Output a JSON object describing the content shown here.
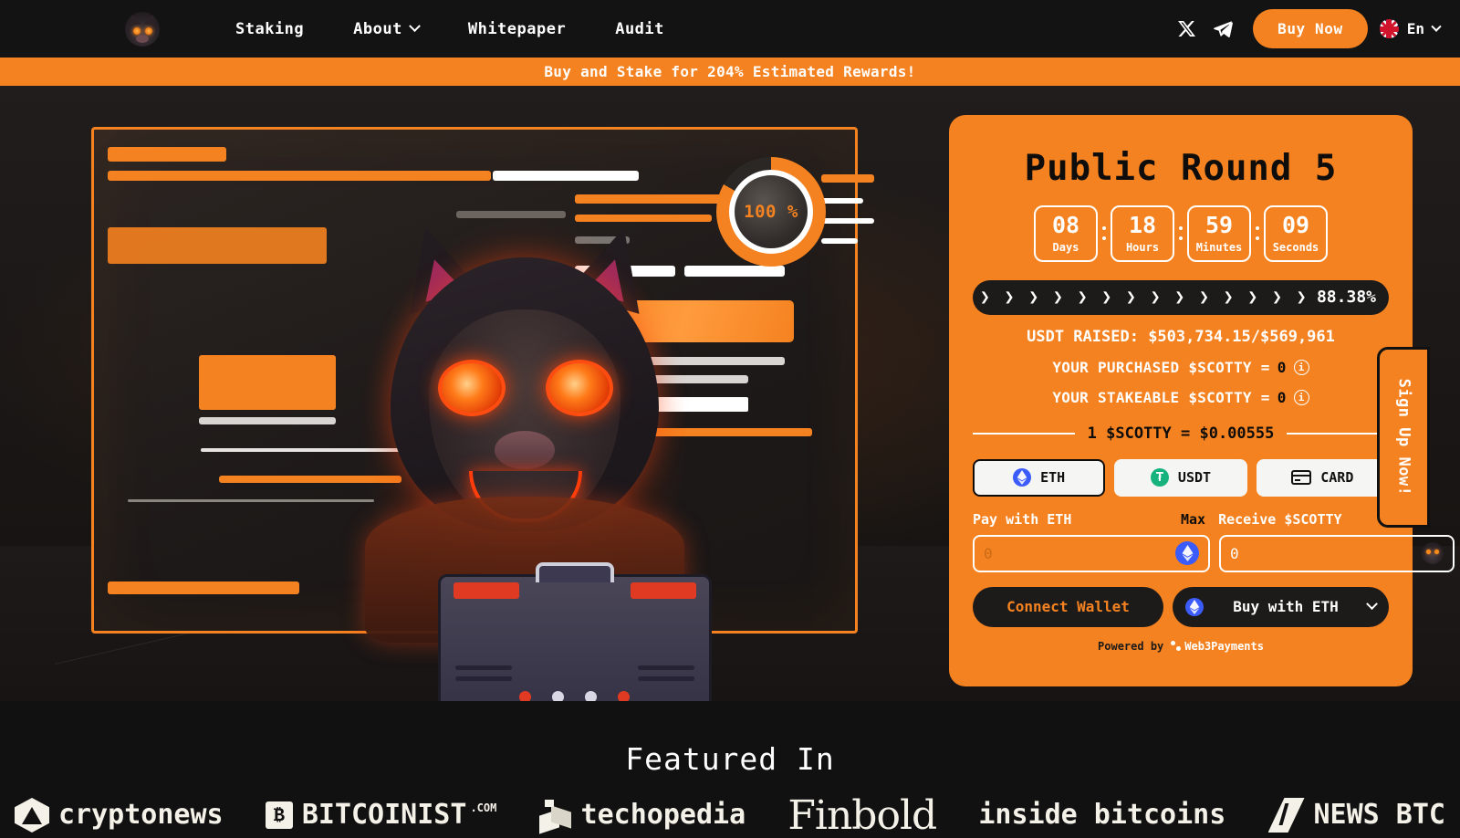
{
  "header": {
    "logo_alt": "scotty-dog-logo",
    "nav": [
      {
        "label": "Staking",
        "has_dropdown": false
      },
      {
        "label": "About",
        "has_dropdown": true
      },
      {
        "label": "Whitepaper",
        "has_dropdown": false
      },
      {
        "label": "Audit",
        "has_dropdown": false
      }
    ],
    "social": [
      {
        "name": "x-twitter-icon"
      },
      {
        "name": "telegram-icon"
      }
    ],
    "buy_now_label": "Buy Now",
    "language": "En"
  },
  "ticker": {
    "text": "Buy and Stake for 204% Estimated Rewards!"
  },
  "hero": {
    "gauge_value": "100 %"
  },
  "presale": {
    "title": "Public Round 5",
    "countdown": [
      {
        "value": "08",
        "label": "Days"
      },
      {
        "value": "18",
        "label": "Hours"
      },
      {
        "value": "59",
        "label": "Minutes"
      },
      {
        "value": "09",
        "label": "Seconds"
      }
    ],
    "progress": {
      "percent_label": "88.38%",
      "percent_value": 88.38,
      "chevrons": "❯ ❯ ❯ ❯ ❯ ❯ ❯ ❯ ❯ ❯ ❯ ❯ ❯ ❯ ❯ ❯ ❯ ❯ ❯ ❯ ❯ ❯ ❯ ❯ ❯ ❯ ❯ ❯ ❯ ❯ ❯ ❯"
    },
    "raised_label": "USDT RAISED:",
    "raised_value": "$503,734.15/$569,961",
    "purchased_label": "YOUR PURCHASED $SCOTTY =",
    "purchased_value": "0",
    "stakeable_label": "YOUR STAKEABLE $SCOTTY =",
    "stakeable_value": "0",
    "rate": "1 $SCOTTY = $0.00555",
    "pay_tabs": [
      {
        "label": "ETH",
        "icon": "ethereum-icon",
        "active": true
      },
      {
        "label": "USDT",
        "icon": "tether-icon",
        "active": false
      },
      {
        "label": "CARD",
        "icon": "credit-card-icon",
        "active": false
      }
    ],
    "pay_label": "Pay with ETH",
    "max_label": "Max",
    "receive_label": "Receive $SCOTTY",
    "pay_value": "",
    "pay_placeholder": "0",
    "receive_value": "0",
    "receive_placeholder": "0",
    "connect_wallet_label": "Connect Wallet",
    "buy_with_label": "Buy with ETH",
    "powered_by_label": "Powered by",
    "powered_by_brand": "Web3Payments"
  },
  "signup_tab": {
    "label": "Sign Up Now!"
  },
  "featured": {
    "title": "Featured In",
    "logos": [
      {
        "name": "cryptonews-logo",
        "text": "cryptonews",
        "mark": "hex"
      },
      {
        "name": "bitcoinist-logo",
        "text": "BITCOINIST",
        "suffix": ".COM",
        "mark": "btc"
      },
      {
        "name": "techopedia-logo",
        "text": "techopedia",
        "mark": "box"
      },
      {
        "name": "finbold-logo",
        "text": "Finbold",
        "mark": "none"
      },
      {
        "name": "inside-bitcoins-logo",
        "text": "inside bitcoins",
        "mark": "none"
      },
      {
        "name": "newsbtc-logo",
        "text": "NEWS BTC",
        "mark": "nb"
      }
    ]
  },
  "colors": {
    "brand_orange": "#F58220",
    "dark": "#121111",
    "panel_dark": "#1d1b1a",
    "white": "#ffffff"
  }
}
